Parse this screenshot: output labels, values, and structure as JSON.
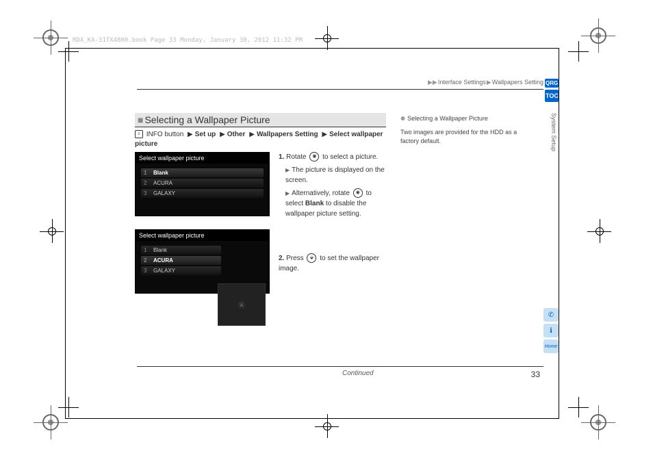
{
  "header": {
    "book_info": "RDX_KA-31TX4800.book  Page 33  Monday, January 30, 2012  11:32 PM"
  },
  "breadcrumb": {
    "b1": "Interface Settings",
    "b2": "Wallpapers Setting"
  },
  "section": {
    "title": "Selecting a Wallpaper Picture"
  },
  "navpath": {
    "prefix": "INFO button",
    "p1": "Set up",
    "p2": "Other",
    "p3": "Wallpapers Setting",
    "p4": "Select wallpaper picture"
  },
  "screenshots": {
    "title": "Select wallpaper picture",
    "items": [
      {
        "n": "1",
        "label": "Blank"
      },
      {
        "n": "2",
        "label": "ACURA"
      },
      {
        "n": "3",
        "label": "GALAXY"
      }
    ],
    "preview_logo": "Ⓐ"
  },
  "steps": {
    "s1": {
      "num": "1.",
      "verb": "Rotate",
      "rest": "to select a picture.",
      "sub1": "The picture is displayed on the screen.",
      "sub2a": "Alternatively, rotate",
      "sub2b": "to select",
      "sub2c": "Blank",
      "sub2d": "to disable the wallpaper picture setting."
    },
    "s2": {
      "num": "2.",
      "verb": "Press",
      "rest": "to set the wallpaper image."
    }
  },
  "sidebar": {
    "title": "Selecting a Wallpaper Picture",
    "body": "Two images are provided for the HDD as a factory default."
  },
  "footer": {
    "continued": "Continued",
    "page": "33"
  },
  "tabs": {
    "qrg": "QRG",
    "toc": "TOC",
    "vlabel": "System Setup"
  },
  "icons": {
    "voice": "✆",
    "info": "ℹ",
    "home": "Home"
  }
}
